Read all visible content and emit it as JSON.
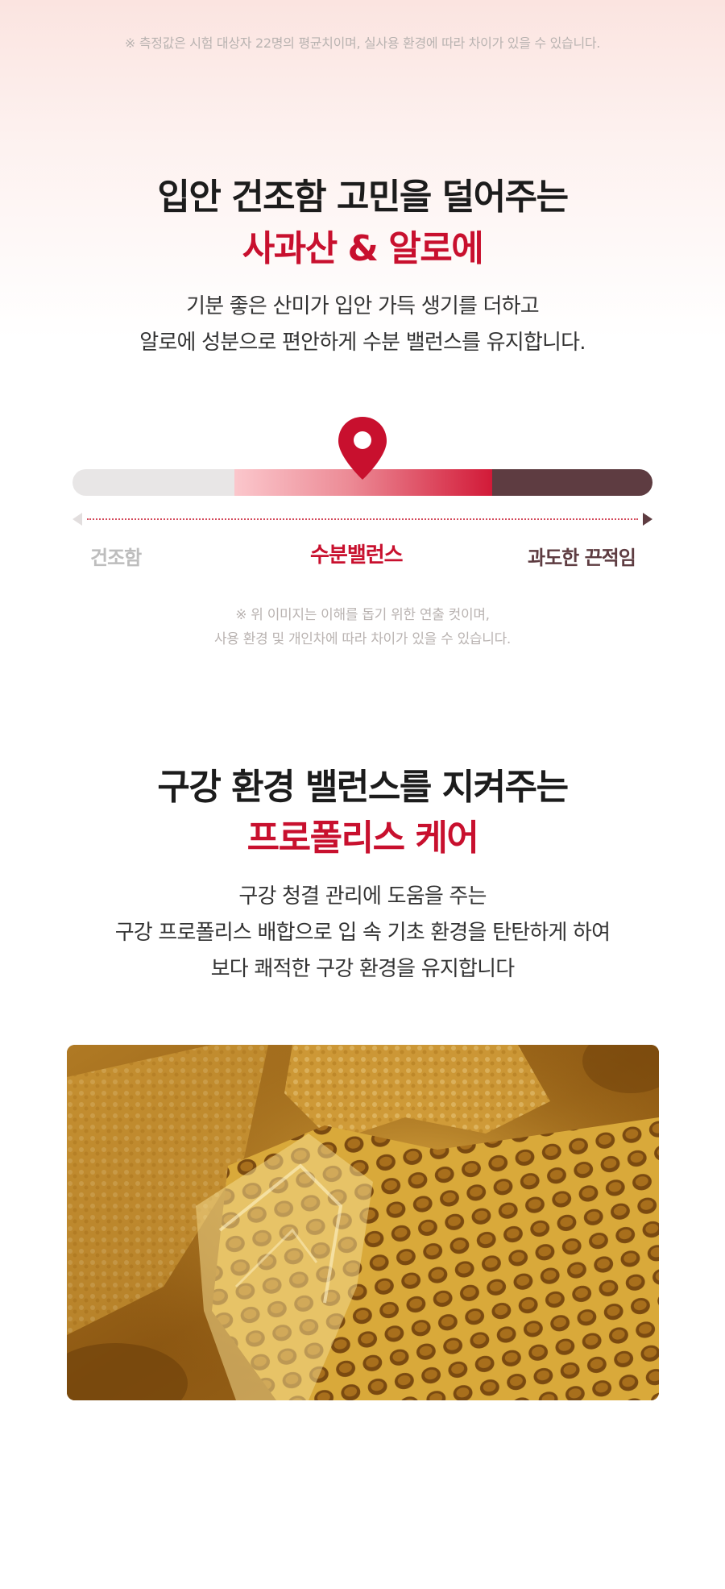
{
  "disclaimer_top": "※ 측정값은 시험 대상자 22명의 평균치이며, 실사용 환경에 따라 차이가 있을 수 있습니다.",
  "section1": {
    "headline_line1": "입안 건조함 고민을 덜어주는",
    "headline_line2": "사과산 & 알로에",
    "body_line1": "기분 좋은 산미가 입안 가득 생기를 더하고",
    "body_line2": "알로에 성분으로 편안하게 수분 밸런스를 유지합니다."
  },
  "gauge": {
    "label_left": "건조함",
    "label_mid": "수분밸런스",
    "label_right": "과도한 끈적임",
    "colors": {
      "dry": "#e8e6e6",
      "balance": "#d21a38",
      "sticky": "#5e3c41"
    }
  },
  "disclaimer_mid": {
    "line1": "※ 위 이미지는 이해를 돕기 위한 연출 컷이며,",
    "line2": "사용 환경 및 개인차에 따라 차이가 있을 수 있습니다."
  },
  "section2": {
    "headline_line1": "구강 환경 밸런스를 지켜주는",
    "headline_line2": "프로폴리스 케어",
    "body_line1": "구강 청결 관리에 도움을 주는",
    "body_line2": "구강 프로폴리스 배합으로 입 속 기초 환경을 탄탄하게 하여",
    "body_line3": "보다 쾌적한 구강 환경을 유지합니다"
  },
  "accent_color": "#c8102e",
  "icons": {
    "pin": "location-pin-icon"
  }
}
